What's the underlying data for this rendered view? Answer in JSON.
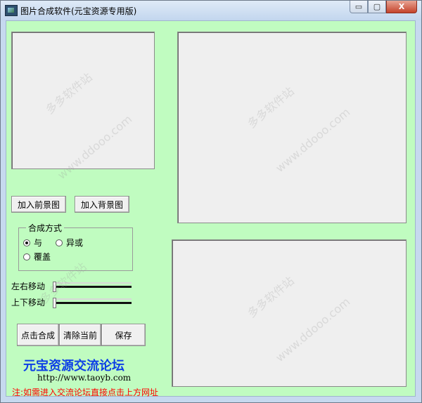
{
  "window": {
    "title": "图片合成软件(元宝资源专用版)",
    "caption_buttons": {
      "minimize": "▭",
      "maximize": "▢",
      "close": "X"
    }
  },
  "buttons": {
    "add_foreground": "加入前景图",
    "add_background": "加入背景图",
    "compose": "点击合成",
    "clear": "清除当前",
    "save": "保存"
  },
  "blend_mode": {
    "legend": "合成方式",
    "options": [
      "与",
      "异或",
      "覆盖"
    ],
    "selected": "与"
  },
  "sliders": {
    "horizontal_label": "左右移动",
    "horizontal_value": 0,
    "vertical_label": "上下移动",
    "vertical_value": 0
  },
  "footer": {
    "forum_title": "元宝资源交流论坛",
    "forum_url": "http://www.taoyb.com",
    "note": "注:如需进入交流论坛直接点击上方网址"
  },
  "watermarks": {
    "site_cn": "多多软件站",
    "site_url": "www.ddooo.com"
  }
}
